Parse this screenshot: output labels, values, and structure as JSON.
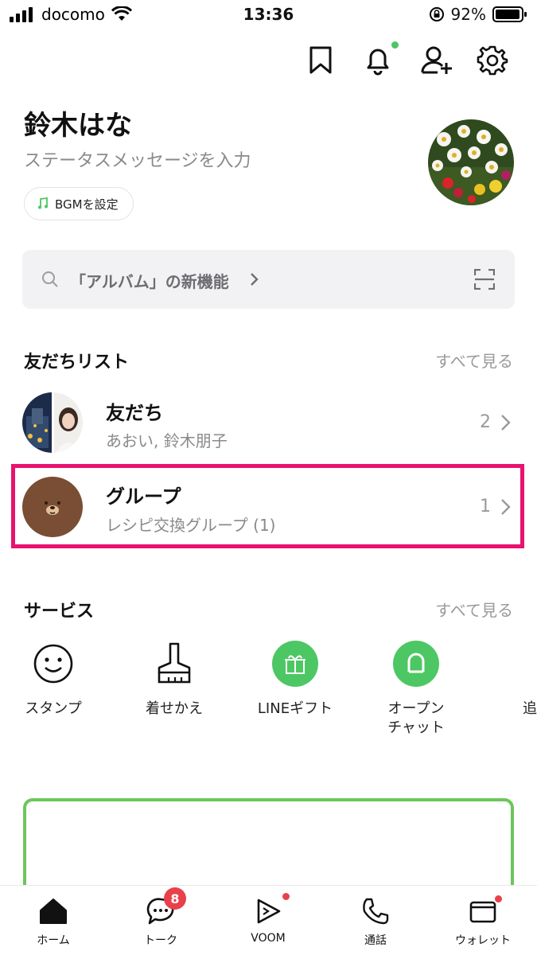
{
  "status_bar": {
    "carrier": "docomo",
    "time": "13:36",
    "battery": "92%"
  },
  "header": {
    "icons": [
      "bookmark-icon",
      "bell-icon",
      "add-friend-icon",
      "gear-icon"
    ]
  },
  "profile": {
    "name": "鈴木はな",
    "status_placeholder": "ステータスメッセージを入力",
    "bgm_button": "BGMを設定"
  },
  "search": {
    "text": "「アルバム」の新機能"
  },
  "friends_section": {
    "title": "友だちリスト",
    "see_all": "すべて見る",
    "rows": [
      {
        "title": "友だち",
        "subtitle": "あおい, 鈴木朋子",
        "count": "2"
      },
      {
        "title": "グループ",
        "subtitle": "レシピ交換グループ (1)",
        "count": "1"
      }
    ]
  },
  "services_section": {
    "title": "サービス",
    "see_all": "すべて見る",
    "items": [
      {
        "label": "スタンプ",
        "icon": "smile-icon"
      },
      {
        "label": "着せかえ",
        "icon": "brush-icon"
      },
      {
        "label": "LINEギフト",
        "icon": "gift-icon"
      },
      {
        "label": "オープン\nチャット",
        "icon": "open-chat-icon"
      },
      {
        "label": "追",
        "icon": "plus-icon"
      }
    ]
  },
  "tab_bar": {
    "tabs": [
      {
        "label": "ホーム",
        "icon": "home-icon"
      },
      {
        "label": "トーク",
        "icon": "chat-icon",
        "badge": "8"
      },
      {
        "label": "VOOM",
        "icon": "voom-icon"
      },
      {
        "label": "通話",
        "icon": "phone-icon"
      },
      {
        "label": "ウォレット",
        "icon": "wallet-icon"
      }
    ]
  },
  "colors": {
    "accent_green": "#4cc764",
    "highlight": "#e8136f",
    "badge_red": "#e8414a"
  }
}
